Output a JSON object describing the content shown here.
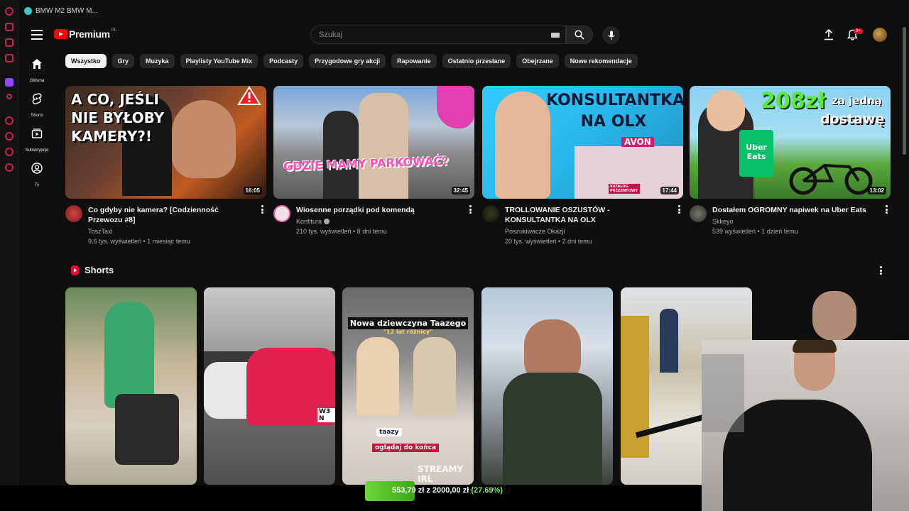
{
  "browser": {
    "tab_title": "BMW M2 BMW M..."
  },
  "sidebar": {
    "items": [
      {
        "label": "Główna",
        "icon": "home-icon"
      },
      {
        "label": "Shorts",
        "icon": "shorts-icon"
      },
      {
        "label": "Subskrypcje",
        "icon": "subscriptions-icon"
      },
      {
        "label": "Ty",
        "icon": "user-icon"
      }
    ]
  },
  "header": {
    "logo_text": "Premium",
    "logo_region": "PL",
    "search_placeholder": "Szukaj",
    "notifications": "9+"
  },
  "chips": [
    "Wszystko",
    "Gry",
    "Muzyka",
    "Playlisty YouTube Mix",
    "Podcasty",
    "Przygodowe gry akcji",
    "Rapowanie",
    "Ostatnio przesłane",
    "Obejrzane",
    "Nowe rekomendacje"
  ],
  "videos": [
    {
      "thumb_text": "A CO, JEŚLI NIE BYŁOBY KAMERY?!",
      "duration": "16:05",
      "title": "Co gdyby nie kamera? [Codzienność Przewozu #8]",
      "channel": "ToszTaxi",
      "meta": "9,6 tys. wyświetleń • 1 miesiąc temu"
    },
    {
      "thumb_text": "GDZIE MAMY PARKOWAĆ?",
      "duration": "32:45",
      "title": "Wiosenne porządki pod komendą",
      "channel": "Konfitura",
      "meta": "210 tys. wyświetleń • 8 dni temu"
    },
    {
      "thumb_text": "KONSULTANTKA NA OLX",
      "thumb_sub": "AVON",
      "thumb_badge": "KATALOG PREZENTOWY",
      "duration": "17:44",
      "title": "TROLLOWANIE OSZUSTÓW - KONSULTANTKA NA OLX",
      "channel": "Poszukiwacze Okazji",
      "meta": "20 tys. wyświetleń • 2 dni temu"
    },
    {
      "thumb_text_1": "208zł",
      "thumb_text_2": "za jedną",
      "thumb_text_3": "dostawę",
      "thumb_bag": "Uber Eats",
      "duration": "13:02",
      "title": "Dostałem OGROMNY napiwek na Uber Eats",
      "channel": "Skkeyo",
      "meta": "539 wyświetleń • 1 dzień temu"
    }
  ],
  "shorts": {
    "title": "Shorts",
    "items": [
      {
        "caption": ""
      },
      {
        "caption": "W3 N"
      },
      {
        "caption": "Nowa dziewczyna Taazego",
        "sub": "\"12 lat różnicy\"",
        "handle": "taazy",
        "cta": "oglądaj do końca",
        "watermark": "STREAMY IRL"
      },
      {
        "caption": ""
      },
      {
        "caption": ""
      },
      {
        "caption": ""
      }
    ]
  },
  "donation_goal": {
    "current": "553,79 zł",
    "joiner": "z",
    "target": "2000,00 zł",
    "percent_text": "(27.69%)",
    "fraction": 0.2769
  }
}
